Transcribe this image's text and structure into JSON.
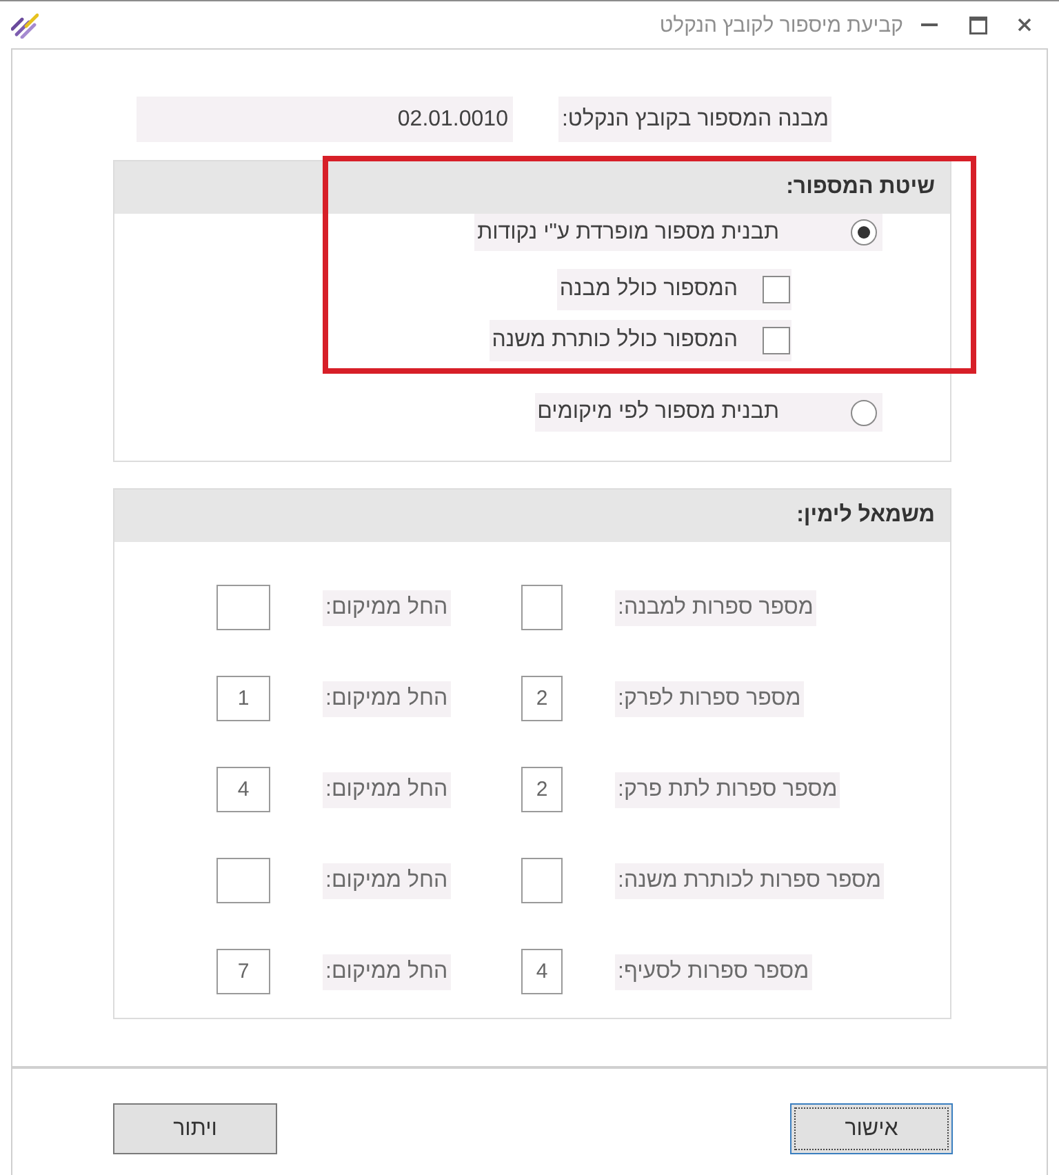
{
  "window": {
    "title": "קביעת מיספור לקובץ הנקלט"
  },
  "structure_field": {
    "label": "מבנה המספור בקובץ הנקלט:",
    "value": "02.01.0010"
  },
  "numbering_method": {
    "title": "שיטת המספור:",
    "highlighted": true,
    "options": [
      {
        "label": "תבנית מספור מופרדת ע\"י נקודות",
        "selected": true,
        "checkboxes": [
          {
            "label": "המספור כולל מבנה",
            "checked": false
          },
          {
            "label": "המספור כולל כותרת משנה",
            "checked": false
          }
        ]
      },
      {
        "label": "תבנית מספור לפי מיקומים",
        "selected": false
      }
    ]
  },
  "left_to_right": {
    "title": "משמאל לימין:",
    "rows": [
      {
        "digits_label": "מספר ספרות למבנה:",
        "start_label": "החל ממיקום:"
      },
      {
        "digits_label": "מספר ספרות לפרק:",
        "digits_value": "2",
        "start_label": "החל ממיקום:",
        "start_value": "1"
      },
      {
        "digits_label": "מספר ספרות לתת פרק:",
        "digits_value": "2",
        "start_label": "החל ממיקום:",
        "start_value": "4"
      },
      {
        "digits_label": "מספר ספרות לכותרת משנה:",
        "start_label": "החל ממיקום:"
      },
      {
        "digits_label": "מספר ספרות לסעיף:",
        "digits_value": "4",
        "start_label": "החל ממיקום:",
        "start_value": "7"
      }
    ]
  },
  "buttons": [
    {
      "label": "אישור",
      "focused": true
    },
    {
      "label": "ויתור",
      "focused": false
    }
  ]
}
